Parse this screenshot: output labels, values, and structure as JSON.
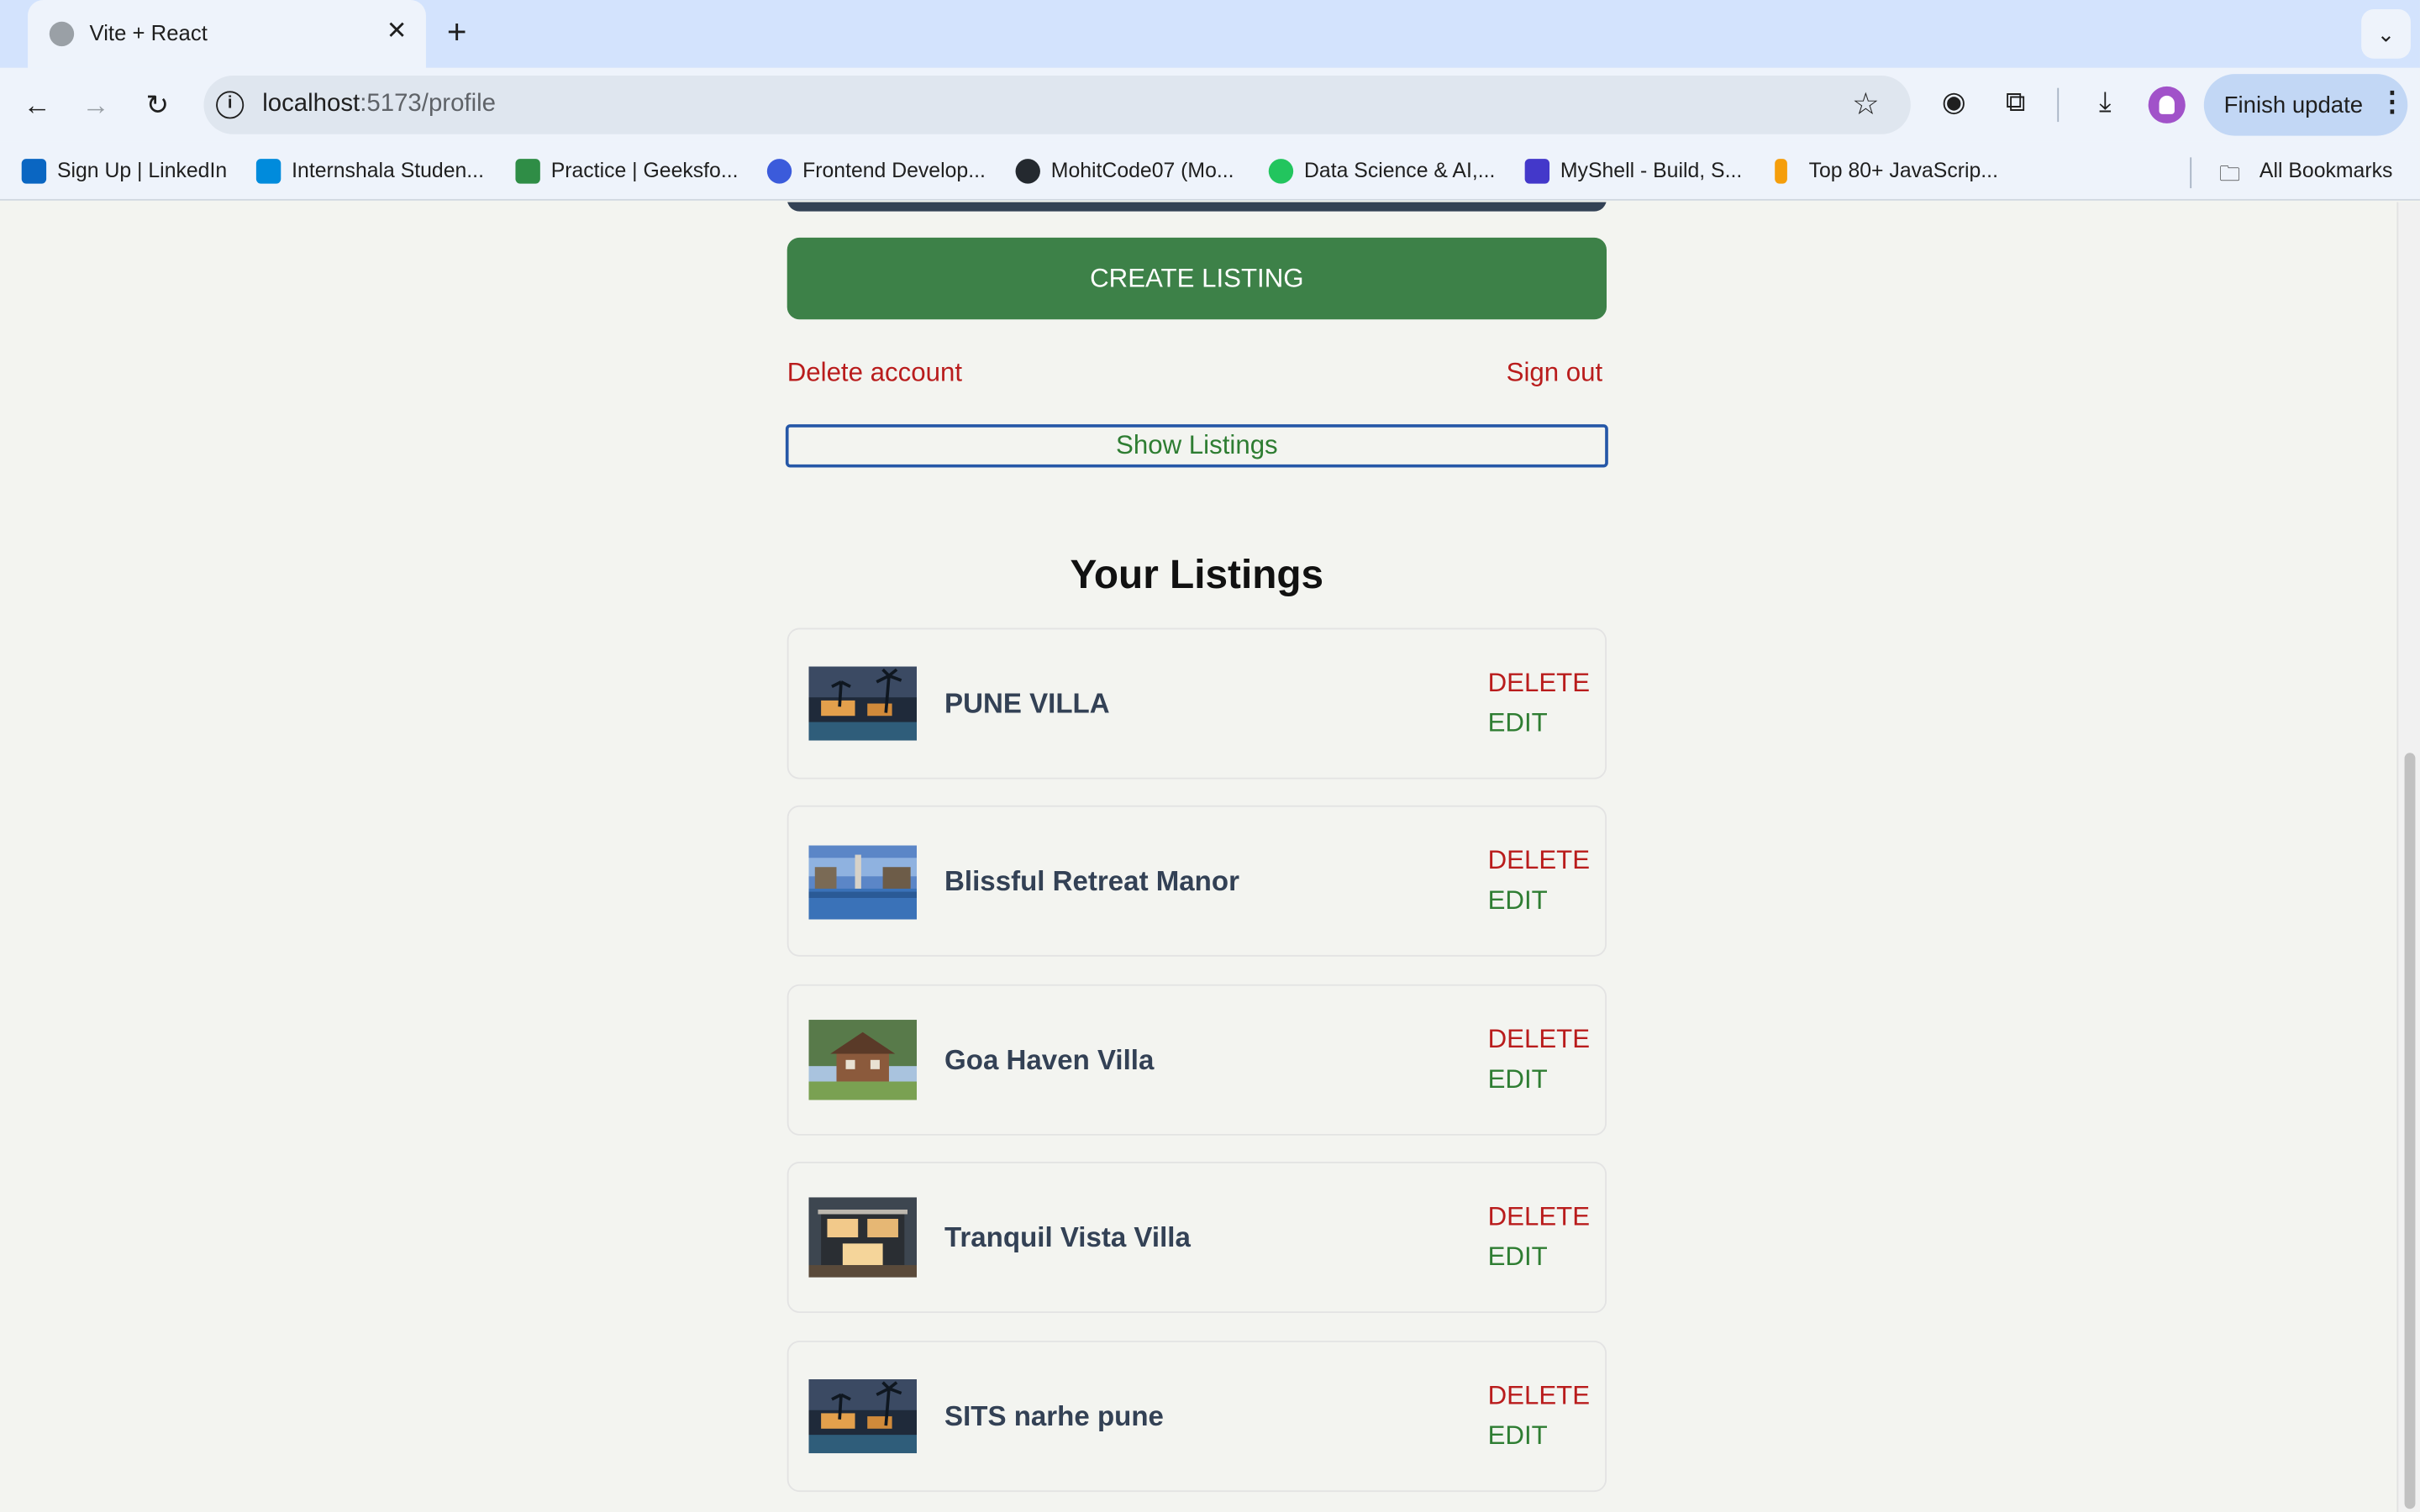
{
  "browser": {
    "tab_title": "Vite + React",
    "tab_close": "✕",
    "new_tab": "+",
    "url_host": "localhost",
    "url_path": ":5173/profile",
    "finish_update": "Finish update",
    "bookmarks": [
      {
        "label": "Sign Up | LinkedIn",
        "icon": "linkedin-icon",
        "color": "#0a66c2"
      },
      {
        "label": "Internshala Studen...",
        "icon": "internshala-icon",
        "color": "#008bdc"
      },
      {
        "label": "Practice | Geeksfo...",
        "icon": "geeksforgeeks-icon",
        "color": "#2f8d46"
      },
      {
        "label": "Frontend Develop...",
        "icon": "frontend-icon",
        "color": "#3b5bdb"
      },
      {
        "label": "MohitCode07 (Mo...",
        "icon": "github-icon",
        "color": "#24292f"
      },
      {
        "label": "Data Science & AI,...",
        "icon": "datascience-icon",
        "color": "#22c55e"
      },
      {
        "label": "MyShell - Build, S...",
        "icon": "myshell-icon",
        "color": "#4338ca"
      },
      {
        "label": "Top 80+ JavaScrip...",
        "icon": "javascript-icon",
        "color": "#f59e0b"
      }
    ],
    "all_bookmarks": "All Bookmarks"
  },
  "profile": {
    "create_listing": "CREATE LISTING",
    "delete_account": "Delete account",
    "sign_out": "Sign out",
    "show_listings": "Show Listings"
  },
  "listings": {
    "title": "Your Listings",
    "delete_label": "DELETE",
    "edit_label": "EDIT",
    "items": [
      {
        "name": "PUNE VILLA",
        "image": "villa-night"
      },
      {
        "name": "Blissful Retreat Manor",
        "image": "resort-pool"
      },
      {
        "name": "Goa Haven Villa",
        "image": "brick-house"
      },
      {
        "name": "Tranquil Vista Villa",
        "image": "modern-house"
      },
      {
        "name": "SITS narhe pune",
        "image": "villa-night"
      }
    ]
  },
  "colors": {
    "accent_green": "#3d8148",
    "danger_red": "#b91c1c",
    "edit_green": "#2e7d32"
  }
}
